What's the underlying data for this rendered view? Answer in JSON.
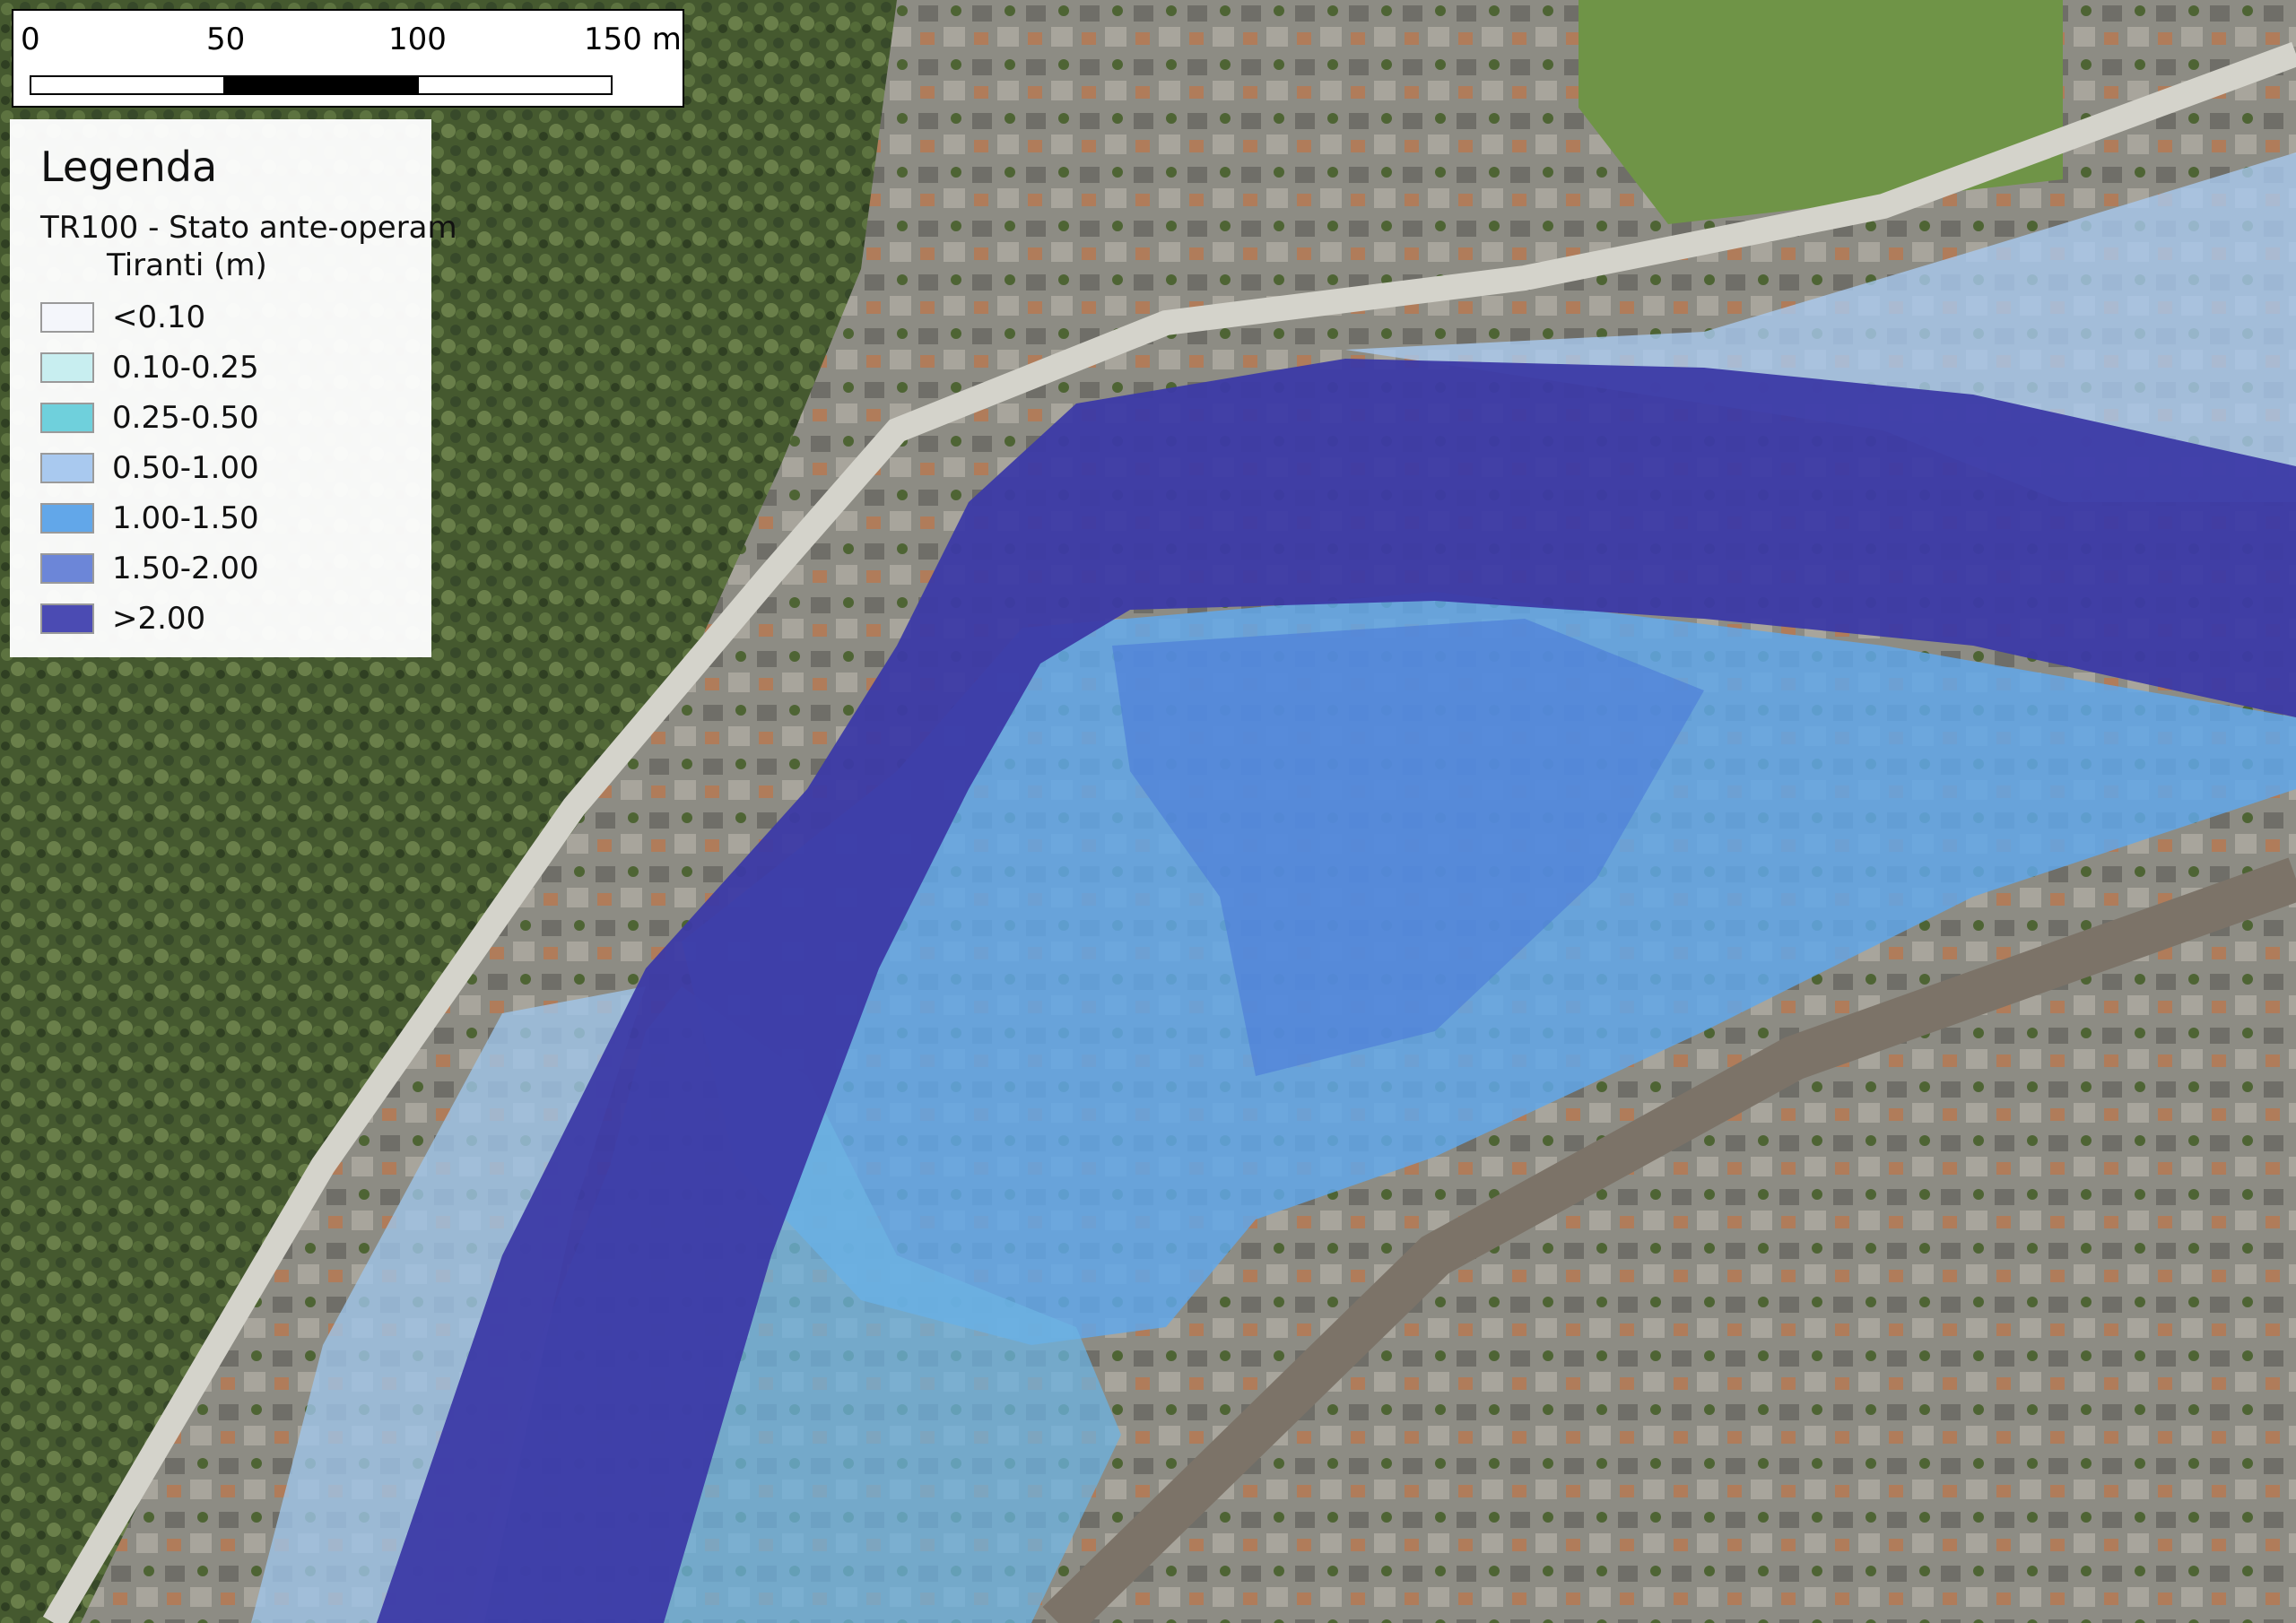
{
  "scalebar": {
    "ticks": [
      "0",
      "50",
      "100",
      "150 m"
    ]
  },
  "legend": {
    "title": "Legenda",
    "layer": "TR100 - Stato ante-operam",
    "sublayer": "Tiranti (m)",
    "items": [
      {
        "label": "<0.10",
        "color": "#f4f6fb"
      },
      {
        "label": "0.10-0.25",
        "color": "#c8eef0"
      },
      {
        "label": "0.25-0.50",
        "color": "#6fd0dc"
      },
      {
        "label": "0.50-1.00",
        "color": "#a9c9ef"
      },
      {
        "label": "1.00-1.50",
        "color": "#62a7e9"
      },
      {
        "label": "1.50-2.00",
        "color": "#6c86d8"
      },
      {
        "label": ">2.00",
        "color": "#4b4bb3"
      }
    ]
  },
  "colors": {
    "vegetation": "#3f5530",
    "urban": "#8f8f86",
    "river_deep": "#3c3aa6",
    "road": "#d6d6d0"
  }
}
